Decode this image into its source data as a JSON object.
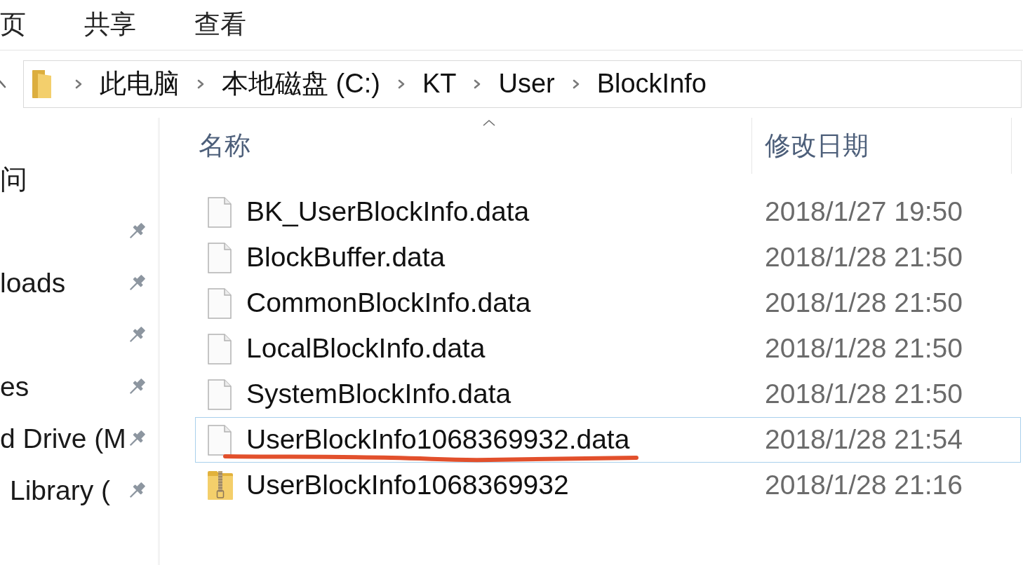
{
  "ribbon_tabs": [
    "页",
    "共享",
    "查看"
  ],
  "address_bar": {
    "segments": [
      "此电脑",
      "本地磁盘 (C:)",
      "KT",
      "User",
      "BlockInfo"
    ]
  },
  "navigation_pane": {
    "items": [
      {
        "label": "问",
        "pinned": false
      },
      {
        "pinned": true
      },
      {
        "label": "loads",
        "pinned": true
      },
      {
        "pinned": true
      },
      {
        "label": "es",
        "pinned": true
      },
      {
        "label": "d Drive (M",
        "pinned": true
      },
      {
        "label": "Library (",
        "pinned": true
      }
    ]
  },
  "file_list": {
    "columns": [
      {
        "label": "名称",
        "sorted": true
      },
      {
        "label": "修改日期",
        "sorted": false
      }
    ],
    "rows": [
      {
        "kind": "document",
        "name": "BK_UserBlockInfo.data",
        "modified": "2018/1/27 19:50",
        "focused": false,
        "underlined": false
      },
      {
        "kind": "document",
        "name": "BlockBuffer.data",
        "modified": "2018/1/28 21:50",
        "focused": false,
        "underlined": false
      },
      {
        "kind": "document",
        "name": "CommonBlockInfo.data",
        "modified": "2018/1/28 21:50",
        "focused": false,
        "underlined": false
      },
      {
        "kind": "document",
        "name": "LocalBlockInfo.data",
        "modified": "2018/1/28 21:50",
        "focused": false,
        "underlined": false
      },
      {
        "kind": "document",
        "name": "SystemBlockInfo.data",
        "modified": "2018/1/28 21:50",
        "focused": false,
        "underlined": false
      },
      {
        "kind": "document",
        "name": "UserBlockInfo1068369932.data",
        "modified": "2018/1/28 21:54",
        "focused": true,
        "underlined": true
      },
      {
        "kind": "zip-folder",
        "name": "UserBlockInfo1068369932",
        "modified": "2018/1/28 21:16",
        "focused": false,
        "underlined": false
      }
    ]
  }
}
